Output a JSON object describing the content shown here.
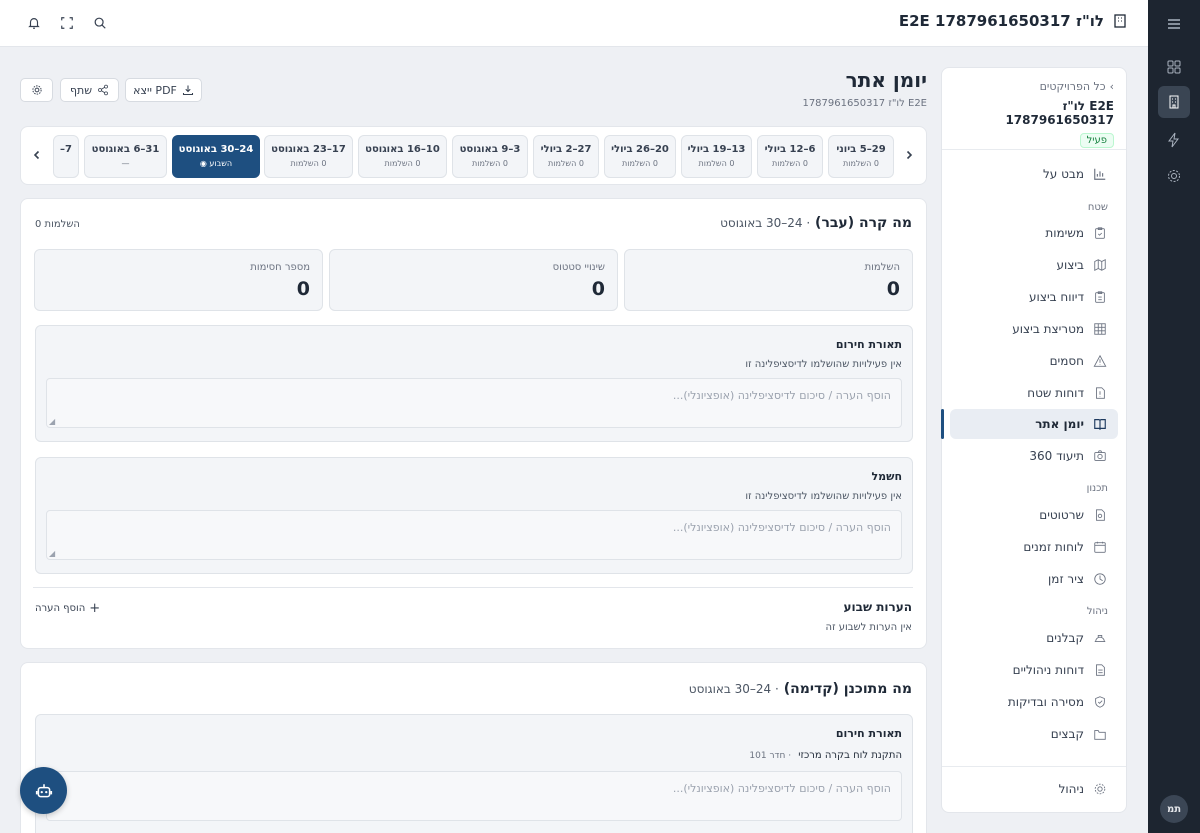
{
  "app": {
    "brand": "E2E לו\"ז 1787961650317"
  },
  "page": {
    "title": "יומן אתר",
    "subtitle": "E2E לו\"ז 1787961650317",
    "buttons": {
      "export_pdf": "ייצא PDF",
      "share": "שתף"
    }
  },
  "sidebar": {
    "back_label": "כל הפרויקטים",
    "project_name": "E2E לו\"ז 1787961650317",
    "status_badge": "פעיל",
    "overview": "מבט על",
    "section_field": "שטח",
    "field_items": [
      "משימות",
      "ביצוע",
      "דיווח ביצוע",
      "מטריצת ביצוע",
      "חסמים",
      "דוחות שטח",
      "יומן אתר",
      "תיעוד 360"
    ],
    "section_planning": "תכנון",
    "planning_items": [
      "שרטוטים",
      "לוחות זמנים",
      "ציר זמן"
    ],
    "section_management": "ניהול",
    "management_items": [
      "קבלנים",
      "דוחות ניהוליים",
      "מסירה ובדיקות",
      "קבצים"
    ],
    "footer_item": "ניהול"
  },
  "rail": {
    "avatar": "תמ"
  },
  "weeks": [
    {
      "label": "29–5 ביוני",
      "sub": "0 השלמות"
    },
    {
      "label": "6–12 ביולי",
      "sub": "0 השלמות"
    },
    {
      "label": "13–19 ביולי",
      "sub": "0 השלמות"
    },
    {
      "label": "20–26 ביולי",
      "sub": "0 השלמות"
    },
    {
      "label": "27–2 ביולי",
      "sub": "0 השלמות"
    },
    {
      "label": "3–9 באוגוסט",
      "sub": "0 השלמות"
    },
    {
      "label": "10–16 באוגוסט",
      "sub": "0 השלמות"
    },
    {
      "label": "17–23 באוגוסט",
      "sub": "0 השלמות"
    },
    {
      "label": "24–30 באוגוסט",
      "sub": "השבוע ◉",
      "selected": true
    },
    {
      "label": "31–6 באוגוסט",
      "sub": "—"
    },
    {
      "label": "7–",
      "sub": ""
    }
  ],
  "past": {
    "title": "מה קרה (עבר)",
    "date": "· 24–30 באוגוסט",
    "count_label": "0 השלמות",
    "stats": [
      {
        "label": "השלמות",
        "value": "0"
      },
      {
        "label": "שינויי סטטוס",
        "value": "0"
      },
      {
        "label": "מספר חסימות",
        "value": "0"
      }
    ],
    "disciplines": [
      {
        "name": "תאורת חירום",
        "desc": "אין פעילויות שהושלמו לדיסציפלינה זו",
        "placeholder": "הוסף הערה / סיכום לדיסציפלינה (אופציונלי)..."
      },
      {
        "name": "חשמל",
        "desc": "אין פעילויות שהושלמו לדיסציפלינה זו",
        "placeholder": "הוסף הערה / סיכום לדיסציפלינה (אופציונלי)..."
      }
    ],
    "week_notes_title": "הערות שבוע",
    "week_notes_empty": "אין הערות לשבוע זה",
    "add_note": "הוסף הערה"
  },
  "future": {
    "title": "מה מתוכנן (קדימה)",
    "date": "· 24–30 באוגוסט",
    "discipline": {
      "name": "תאורת חירום",
      "activity": "התקנת לוח בקרה מרכזי",
      "room": "· חדר 101",
      "placeholder": "הוסף הערה / סיכום לדיסציפלינה (אופציונלי)..."
    }
  },
  "icons": [
    "menu-icon",
    "dashboard-icon",
    "building-icon",
    "bolt-icon",
    "gear-icon",
    "bell-icon",
    "fullscreen-icon",
    "search-icon",
    "download-icon",
    "share-icon",
    "settings-icon",
    "chevron-left-icon",
    "chevron-right-icon",
    "chart-icon",
    "plus-icon",
    "robot-icon"
  ],
  "colors": {
    "accent": "#1e4f80",
    "rail": "#1d2530",
    "active_badge": "#15803d"
  }
}
